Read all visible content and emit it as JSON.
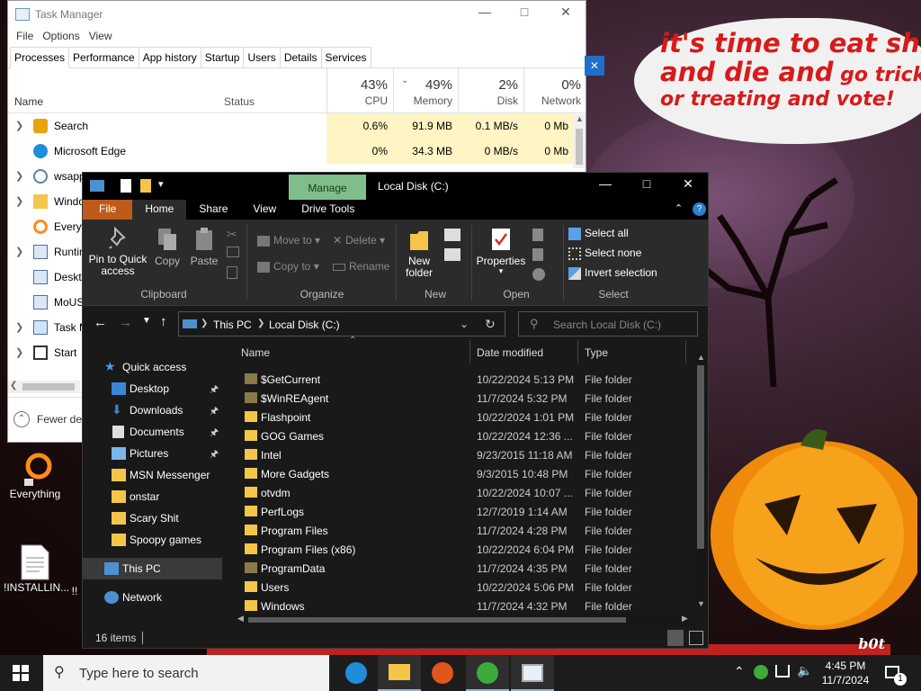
{
  "wallpaper": {
    "speech_line1": "it's time to eat shit",
    "speech_line2_big": "and die and",
    "speech_line2_small": " go trick",
    "speech_line3": "or treating and vote!",
    "corner_text": "b0t"
  },
  "desktop_icons": [
    {
      "label": "Everything"
    },
    {
      "label": "!INSTALLIN..."
    },
    {
      "label": "!!"
    }
  ],
  "task_manager": {
    "title": "Task Manager",
    "menu": [
      "File",
      "Options",
      "View"
    ],
    "tabs": [
      "Processes",
      "Performance",
      "App history",
      "Startup",
      "Users",
      "Details",
      "Services"
    ],
    "active_tab": "Processes",
    "columns": {
      "name": "Name",
      "status": "Status",
      "cpu": {
        "pct": "43%",
        "label": "CPU"
      },
      "memory": {
        "pct": "49%",
        "label": "Memory"
      },
      "disk": {
        "pct": "2%",
        "label": "Disk"
      },
      "network": {
        "pct": "0%",
        "label": "Network"
      }
    },
    "rows": [
      {
        "name": "Search",
        "cpu": "0.6%",
        "memory": "91.9 MB",
        "disk": "0.1 MB/s",
        "network": "0 Mb"
      },
      {
        "name": "Microsoft Edge",
        "cpu": "0%",
        "memory": "34.3 MB",
        "disk": "0 MB/s",
        "network": "0 Mb"
      },
      {
        "name": "wsapp",
        "cpu": "",
        "memory": "",
        "disk": "",
        "network": ""
      },
      {
        "name": "Windo",
        "cpu": "",
        "memory": "",
        "disk": "",
        "network": ""
      },
      {
        "name": "Everyt",
        "cpu": "",
        "memory": "",
        "disk": "",
        "network": ""
      },
      {
        "name": "Runtin",
        "cpu": "",
        "memory": "",
        "disk": "",
        "network": ""
      },
      {
        "name": "Deskto",
        "cpu": "",
        "memory": "",
        "disk": "",
        "network": ""
      },
      {
        "name": "MoUS",
        "cpu": "",
        "memory": "",
        "disk": "",
        "network": ""
      },
      {
        "name": "Task M",
        "cpu": "",
        "memory": "",
        "disk": "",
        "network": ""
      },
      {
        "name": "Start",
        "cpu": "",
        "memory": "",
        "disk": "",
        "network": ""
      }
    ],
    "fewer_details": "Fewer de"
  },
  "explorer": {
    "title": "Local Disk (C:)",
    "manage_tab": "Manage",
    "ribbon_tabs": [
      "File",
      "Home",
      "Share",
      "View",
      "Drive Tools"
    ],
    "active_tab": "Home",
    "clipboard": {
      "pin": "Pin to Quick access",
      "copy": "Copy",
      "paste": "Paste",
      "label": "Clipboard"
    },
    "organize": {
      "move_to": "Move to",
      "copy_to": "Copy to",
      "delete": "Delete",
      "rename": "Rename",
      "label": "Organize"
    },
    "new": {
      "new_folder": "New folder",
      "label": "New"
    },
    "open": {
      "properties": "Properties",
      "label": "Open"
    },
    "select": {
      "select_all": "Select all",
      "select_none": "Select none",
      "invert": "Invert selection",
      "label": "Select"
    },
    "breadcrumb": [
      "This PC",
      "Local Disk (C:)"
    ],
    "search_placeholder": "Search Local Disk (C:)",
    "nav": [
      {
        "label": "Quick access",
        "pinned": false
      },
      {
        "label": "Desktop",
        "pinned": true
      },
      {
        "label": "Downloads",
        "pinned": true
      },
      {
        "label": "Documents",
        "pinned": true
      },
      {
        "label": "Pictures",
        "pinned": true
      },
      {
        "label": "MSN Messenger",
        "pinned": false
      },
      {
        "label": "onstar",
        "pinned": false
      },
      {
        "label": "Scary Shit",
        "pinned": false
      },
      {
        "label": "Spoopy games",
        "pinned": false
      },
      {
        "label": "This PC",
        "pinned": false
      },
      {
        "label": "Network",
        "pinned": false
      }
    ],
    "list_headers": {
      "name": "Name",
      "date": "Date modified",
      "type": "Type"
    },
    "files": [
      {
        "name": "$GetCurrent",
        "date": "10/22/2024 5:13 PM",
        "type": "File folder",
        "hidden": true
      },
      {
        "name": "$WinREAgent",
        "date": "11/7/2024 5:32 PM",
        "type": "File folder",
        "hidden": true
      },
      {
        "name": "Flashpoint",
        "date": "10/22/2024 1:01 PM",
        "type": "File folder",
        "hidden": false
      },
      {
        "name": "GOG Games",
        "date": "10/22/2024 12:36 ...",
        "type": "File folder",
        "hidden": false
      },
      {
        "name": "Intel",
        "date": "9/23/2015 11:18 AM",
        "type": "File folder",
        "hidden": false
      },
      {
        "name": "More Gadgets",
        "date": "9/3/2015 10:48 PM",
        "type": "File folder",
        "hidden": false
      },
      {
        "name": "otvdm",
        "date": "10/22/2024 10:07 ...",
        "type": "File folder",
        "hidden": false
      },
      {
        "name": "PerfLogs",
        "date": "12/7/2019 1:14 AM",
        "type": "File folder",
        "hidden": false
      },
      {
        "name": "Program Files",
        "date": "11/7/2024 4:28 PM",
        "type": "File folder",
        "hidden": false
      },
      {
        "name": "Program Files (x86)",
        "date": "10/22/2024 6:04 PM",
        "type": "File folder",
        "hidden": false
      },
      {
        "name": "ProgramData",
        "date": "11/7/2024 4:35 PM",
        "type": "File folder",
        "hidden": true
      },
      {
        "name": "Users",
        "date": "10/22/2024 5:06 PM",
        "type": "File folder",
        "hidden": false
      },
      {
        "name": "Windows",
        "date": "11/7/2024 4:32 PM",
        "type": "File folder",
        "hidden": false
      }
    ],
    "status_count": "16 items"
  },
  "taskbar": {
    "search_placeholder": "Type here to search",
    "time": "4:45 PM",
    "date": "11/7/2024",
    "notification_count": "1"
  },
  "colors": {
    "file_tab": "#c05a1a",
    "manage_tab": "#7fbe8a",
    "tm_highlight": "#fff4c4",
    "speech_text": "#d81a1a"
  }
}
